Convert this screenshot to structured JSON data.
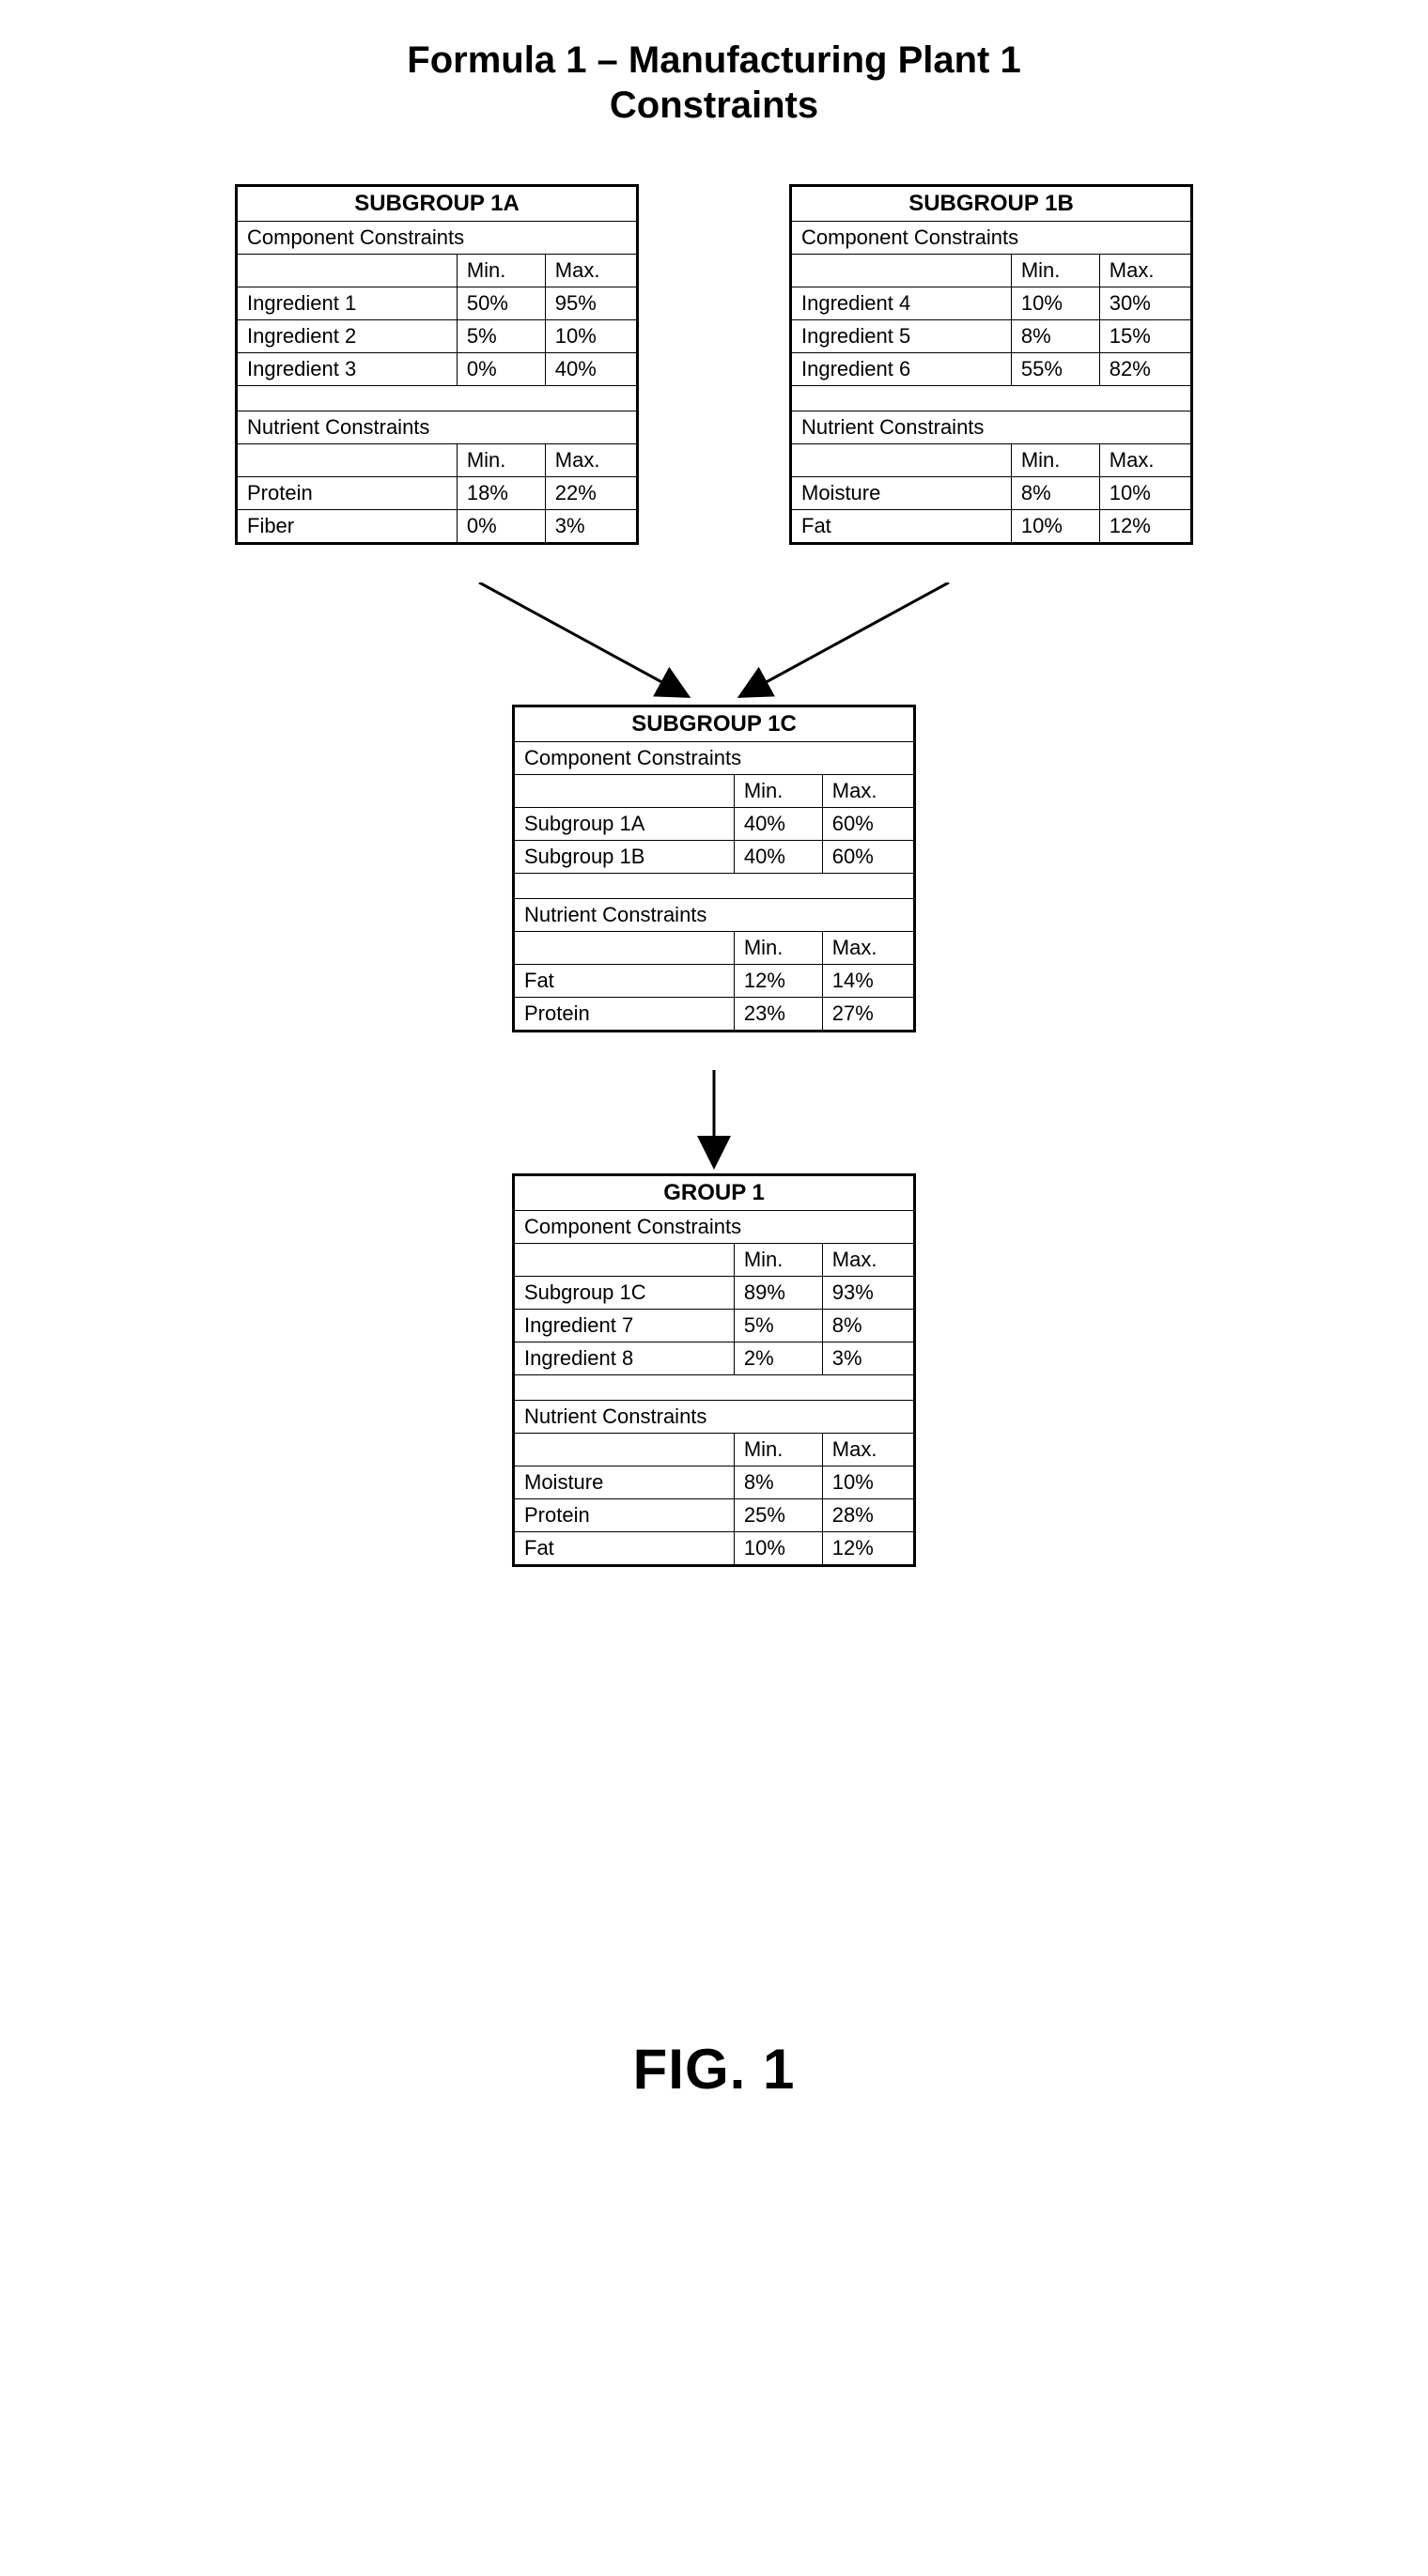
{
  "title_line1": "Formula 1 – Manufacturing Plant 1",
  "title_line2": "Constraints",
  "labels": {
    "component_constraints": "Component Constraints",
    "nutrient_constraints": "Nutrient Constraints",
    "min": "Min.",
    "max": "Max."
  },
  "tables": {
    "sg1a": {
      "title": "SUBGROUP 1A",
      "components": [
        {
          "name": "Ingredient 1",
          "min": "50%",
          "max": "95%"
        },
        {
          "name": "Ingredient 2",
          "min": "5%",
          "max": "10%"
        },
        {
          "name": "Ingredient 3",
          "min": "0%",
          "max": "40%"
        }
      ],
      "nutrients": [
        {
          "name": "Protein",
          "min": "18%",
          "max": "22%"
        },
        {
          "name": "Fiber",
          "min": "0%",
          "max": "3%"
        }
      ]
    },
    "sg1b": {
      "title": "SUBGROUP 1B",
      "components": [
        {
          "name": "Ingredient 4",
          "min": "10%",
          "max": "30%"
        },
        {
          "name": "Ingredient 5",
          "min": "8%",
          "max": "15%"
        },
        {
          "name": "Ingredient 6",
          "min": "55%",
          "max": "82%"
        }
      ],
      "nutrients": [
        {
          "name": "Moisture",
          "min": "8%",
          "max": "10%"
        },
        {
          "name": "Fat",
          "min": "10%",
          "max": "12%"
        }
      ]
    },
    "sg1c": {
      "title": "SUBGROUP 1C",
      "components": [
        {
          "name": "Subgroup 1A",
          "min": "40%",
          "max": "60%"
        },
        {
          "name": "Subgroup 1B",
          "min": "40%",
          "max": "60%"
        }
      ],
      "nutrients": [
        {
          "name": "Fat",
          "min": "12%",
          "max": "14%"
        },
        {
          "name": "Protein",
          "min": "23%",
          "max": "27%"
        }
      ]
    },
    "g1": {
      "title": "GROUP 1",
      "components": [
        {
          "name": "Subgroup 1C",
          "min": "89%",
          "max": "93%"
        },
        {
          "name": "Ingredient 7",
          "min": "5%",
          "max": "8%"
        },
        {
          "name": "Ingredient 8",
          "min": "2%",
          "max": "3%"
        }
      ],
      "nutrients": [
        {
          "name": "Moisture",
          "min": "8%",
          "max": "10%"
        },
        {
          "name": "Protein",
          "min": "25%",
          "max": "28%"
        },
        {
          "name": "Fat",
          "min": "10%",
          "max": "12%"
        }
      ]
    }
  },
  "figure_label": "FIG. 1"
}
